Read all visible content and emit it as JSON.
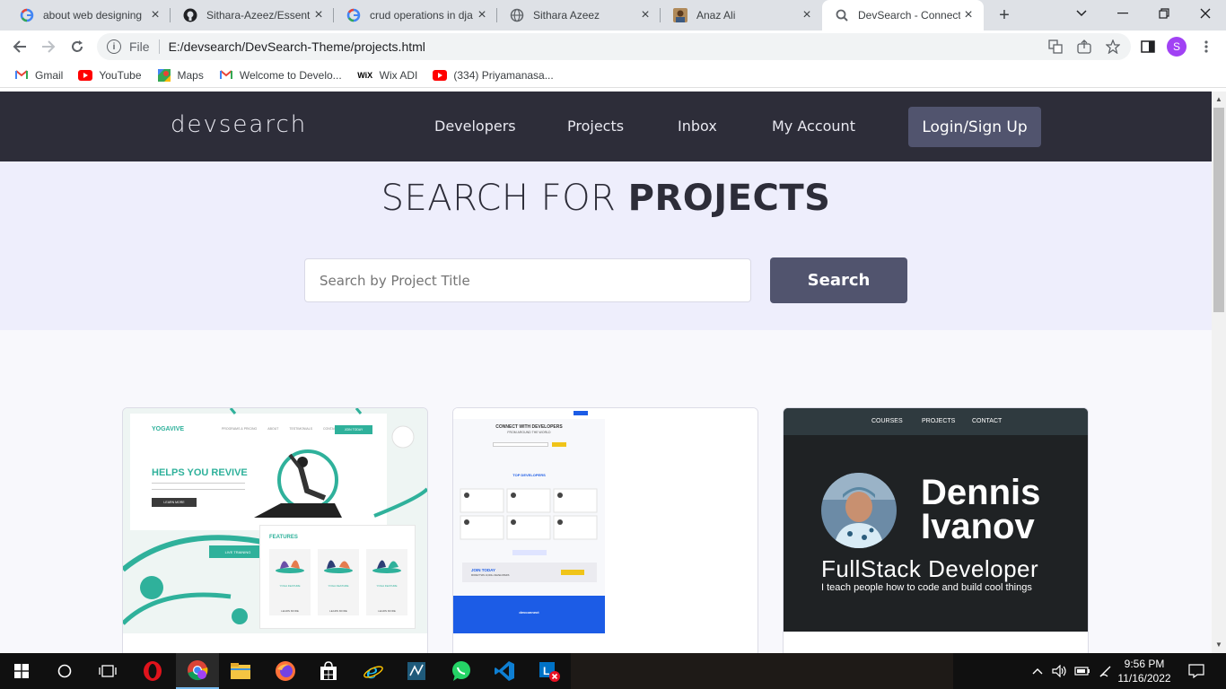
{
  "browser": {
    "tabs": [
      {
        "title": "about web designing",
        "icon": "google-icon"
      },
      {
        "title": "Sithara-Azeez/Essentia",
        "icon": "github-icon"
      },
      {
        "title": "crud operations in dja",
        "icon": "google-icon"
      },
      {
        "title": "Sithara Azeez",
        "icon": "globe-icon"
      },
      {
        "title": "Anaz Ali",
        "icon": "avatar-icon"
      },
      {
        "title": "DevSearch - Connect",
        "icon": "search-icon",
        "active": true
      }
    ],
    "new_tab": "+",
    "address": {
      "protocol": "File",
      "url": "E:/devsearch/DevSearch-Theme/projects.html"
    },
    "profile_initial": "S",
    "bookmarks": [
      {
        "label": "Gmail",
        "icon": "gmail-icon"
      },
      {
        "label": "YouTube",
        "icon": "youtube-icon"
      },
      {
        "label": "Maps",
        "icon": "maps-icon"
      },
      {
        "label": "Welcome to Develo...",
        "icon": "gmail-icon"
      },
      {
        "label": "Wix ADI",
        "icon": "wix-icon"
      },
      {
        "label": "(334) Priyamanasa...",
        "icon": "youtube-icon"
      }
    ]
  },
  "site": {
    "logo": "devsearch",
    "nav": [
      "Developers",
      "Projects",
      "Inbox",
      "My Account"
    ],
    "login_label": "Login/Sign Up",
    "hero": {
      "title_light": "SEARCH FOR ",
      "title_bold": "PROJECTS"
    },
    "search": {
      "placeholder": "Search by Project Title",
      "button": "Search"
    },
    "cards": [
      {
        "brand": "YOGAVIVE",
        "headline": "HELPS YOU REVIVE",
        "nav": [
          "PROGRAMS & PRICING",
          "ABOUT",
          "TESTIMONIALS",
          "CONTACT",
          "JOIN TODAY"
        ],
        "cta": "LEARN MORE",
        "features_title": "FEATURES",
        "feature_labels": [
          "YOGA FEATURE",
          "YOGA FEATURE",
          "YOGA FEATURE"
        ],
        "feature_cta": "LEARN MORE",
        "badge": "LIVE TRAINING"
      },
      {
        "heading": "CONNECT WITH DEVELOPERS",
        "subheading": "FROM AROUND THE WORLD",
        "section_title": "TOP DEVELOPERS",
        "join_title": "JOIN TODAY",
        "join_sub": "MORE THAN 10,000+ DEVELOPERS",
        "footer_logo": "devconnect"
      },
      {
        "nav": [
          "COURSES",
          "PROJECTS",
          "CONTACT"
        ],
        "name_line1": "Dennis",
        "name_line2": "Ivanov",
        "role": "FullStack Developer",
        "tagline": "I teach people how to code and build cool things"
      }
    ]
  },
  "taskbar": {
    "time": "9:56 PM",
    "date": "11/16/2022"
  }
}
